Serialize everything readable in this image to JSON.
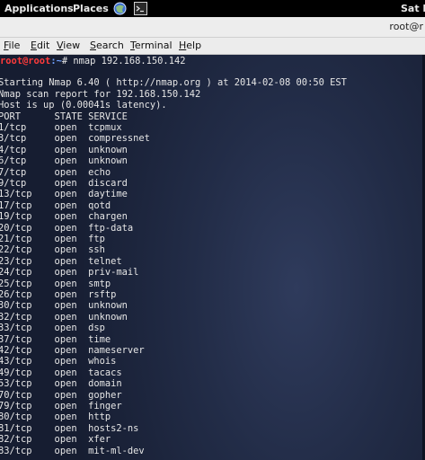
{
  "topbar": {
    "applications": "Applications",
    "places": "Places",
    "clock": "Sat F",
    "icons": [
      "browser-icon",
      "terminal-launcher-icon"
    ]
  },
  "window": {
    "title": "root@r"
  },
  "menu": {
    "items": [
      "File",
      "Edit",
      "View",
      "Search",
      "Terminal",
      "Help"
    ]
  },
  "terminal": {
    "prompt_user": "root@root",
    "prompt_path": ":~",
    "prompt_symbol": "# ",
    "command": "nmap 192.168.150.142",
    "lines": [
      "",
      "Starting Nmap 6.40 ( http://nmap.org ) at 2014-02-08 00:50 EST",
      "Nmap scan report for 192.168.150.142",
      "Host is up (0.00041s latency).",
      "PORT      STATE SERVICE",
      "1/tcp     open  tcpmux",
      "3/tcp     open  compressnet",
      "4/tcp     open  unknown",
      "6/tcp     open  unknown",
      "7/tcp     open  echo",
      "9/tcp     open  discard",
      "13/tcp    open  daytime",
      "17/tcp    open  qotd",
      "19/tcp    open  chargen",
      "20/tcp    open  ftp-data",
      "21/tcp    open  ftp",
      "22/tcp    open  ssh",
      "23/tcp    open  telnet",
      "24/tcp    open  priv-mail",
      "25/tcp    open  smtp",
      "26/tcp    open  rsftp",
      "30/tcp    open  unknown",
      "32/tcp    open  unknown",
      "33/tcp    open  dsp",
      "37/tcp    open  time",
      "42/tcp    open  nameserver",
      "43/tcp    open  whois",
      "49/tcp    open  tacacs",
      "53/tcp    open  domain",
      "70/tcp    open  gopher",
      "79/tcp    open  finger",
      "80/tcp    open  http",
      "81/tcp    open  hosts2-ns",
      "82/tcp    open  xfer",
      "83/tcp    open  mit-ml-dev"
    ]
  }
}
